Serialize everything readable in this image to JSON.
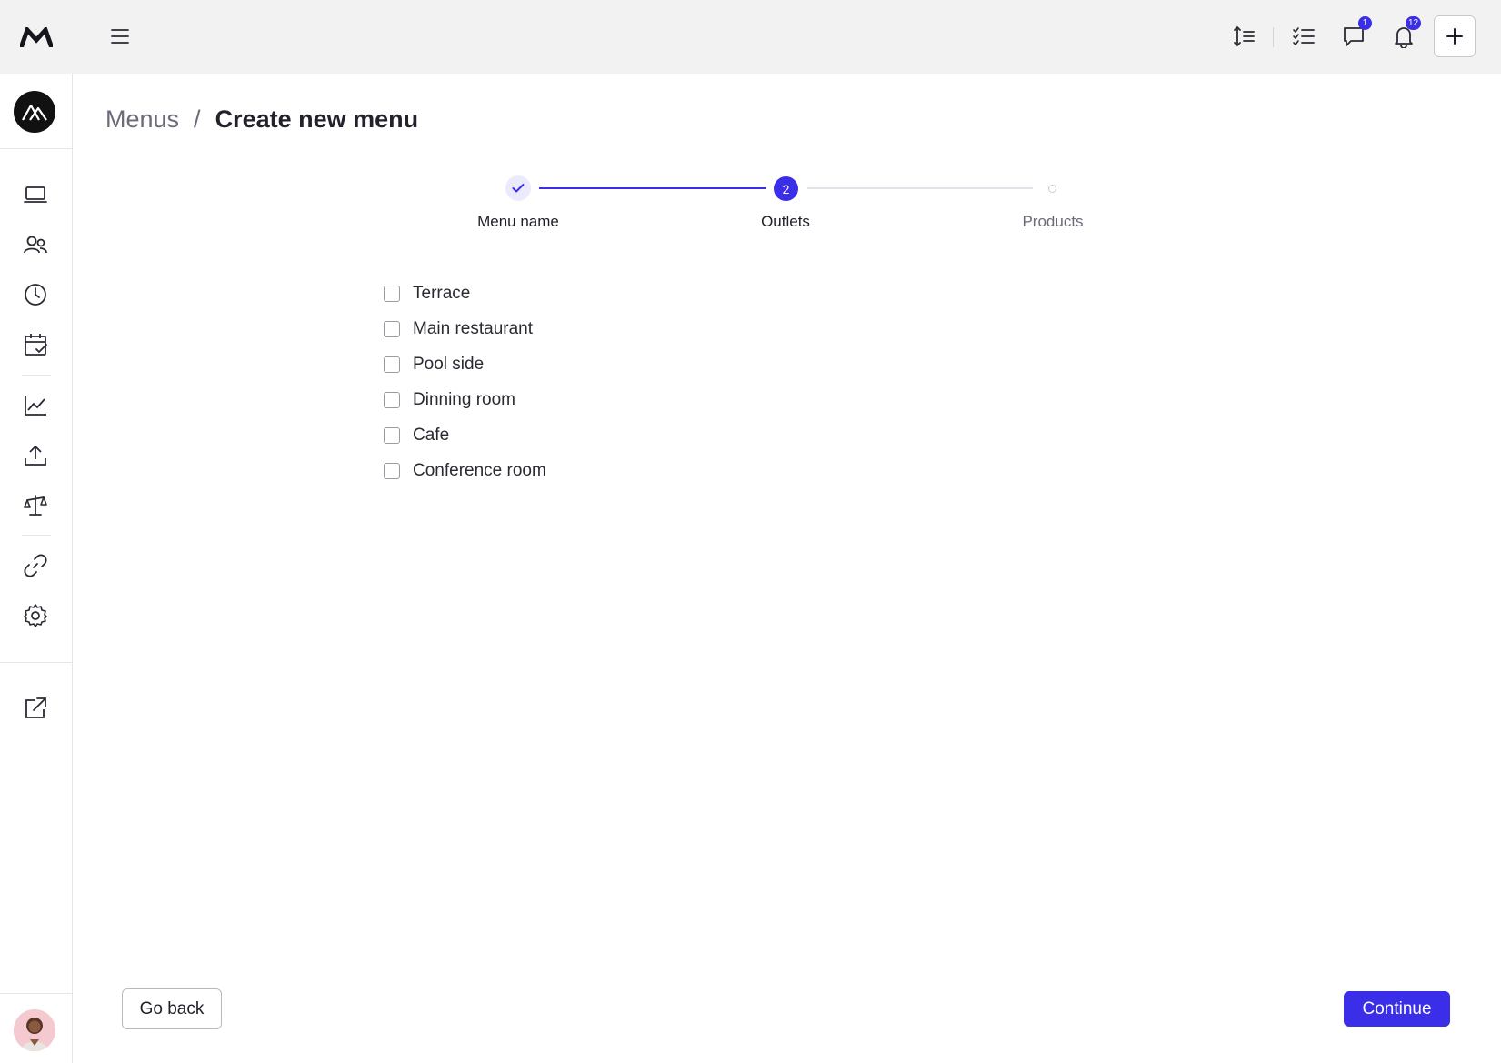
{
  "app": {
    "logo_icon": "brand-m-logo-icon",
    "org_avatar_icon": "mountain-logo-icon",
    "accent_color": "#3a2ee8"
  },
  "sidebar": {
    "items": [
      {
        "name": "laptop-icon"
      },
      {
        "name": "users-icon"
      },
      {
        "name": "clock-icon"
      },
      {
        "name": "calendar-check-icon"
      },
      {
        "name": "chart-line-icon"
      },
      {
        "name": "upload-icon"
      },
      {
        "name": "scale-icon"
      },
      {
        "name": "link-icon"
      },
      {
        "name": "gear-icon"
      },
      {
        "name": "external-link-icon"
      }
    ],
    "user_avatar_icon": "user-avatar-photo"
  },
  "topbar": {
    "menu_icon": "hamburger-menu-icon",
    "icons": [
      "line-height-icon",
      "checklist-icon",
      "chat-icon",
      "bell-icon",
      "plus-icon"
    ],
    "chat_badge": "1",
    "notification_badge": "12"
  },
  "breadcrumb": {
    "parent": "Menus",
    "separator": "/",
    "current": "Create new menu"
  },
  "stepper": {
    "steps": [
      {
        "label": "Menu name",
        "state": "done"
      },
      {
        "label": "Outlets",
        "state": "active",
        "number": "2"
      },
      {
        "label": "Products",
        "state": "pending"
      }
    ]
  },
  "outlets": [
    {
      "label": "Terrace",
      "checked": false
    },
    {
      "label": "Main restaurant",
      "checked": false
    },
    {
      "label": "Pool side",
      "checked": false
    },
    {
      "label": "Dinning room",
      "checked": false
    },
    {
      "label": "Cafe",
      "checked": false
    },
    {
      "label": "Conference room",
      "checked": false
    }
  ],
  "footer": {
    "back_label": "Go back",
    "continue_label": "Continue"
  }
}
